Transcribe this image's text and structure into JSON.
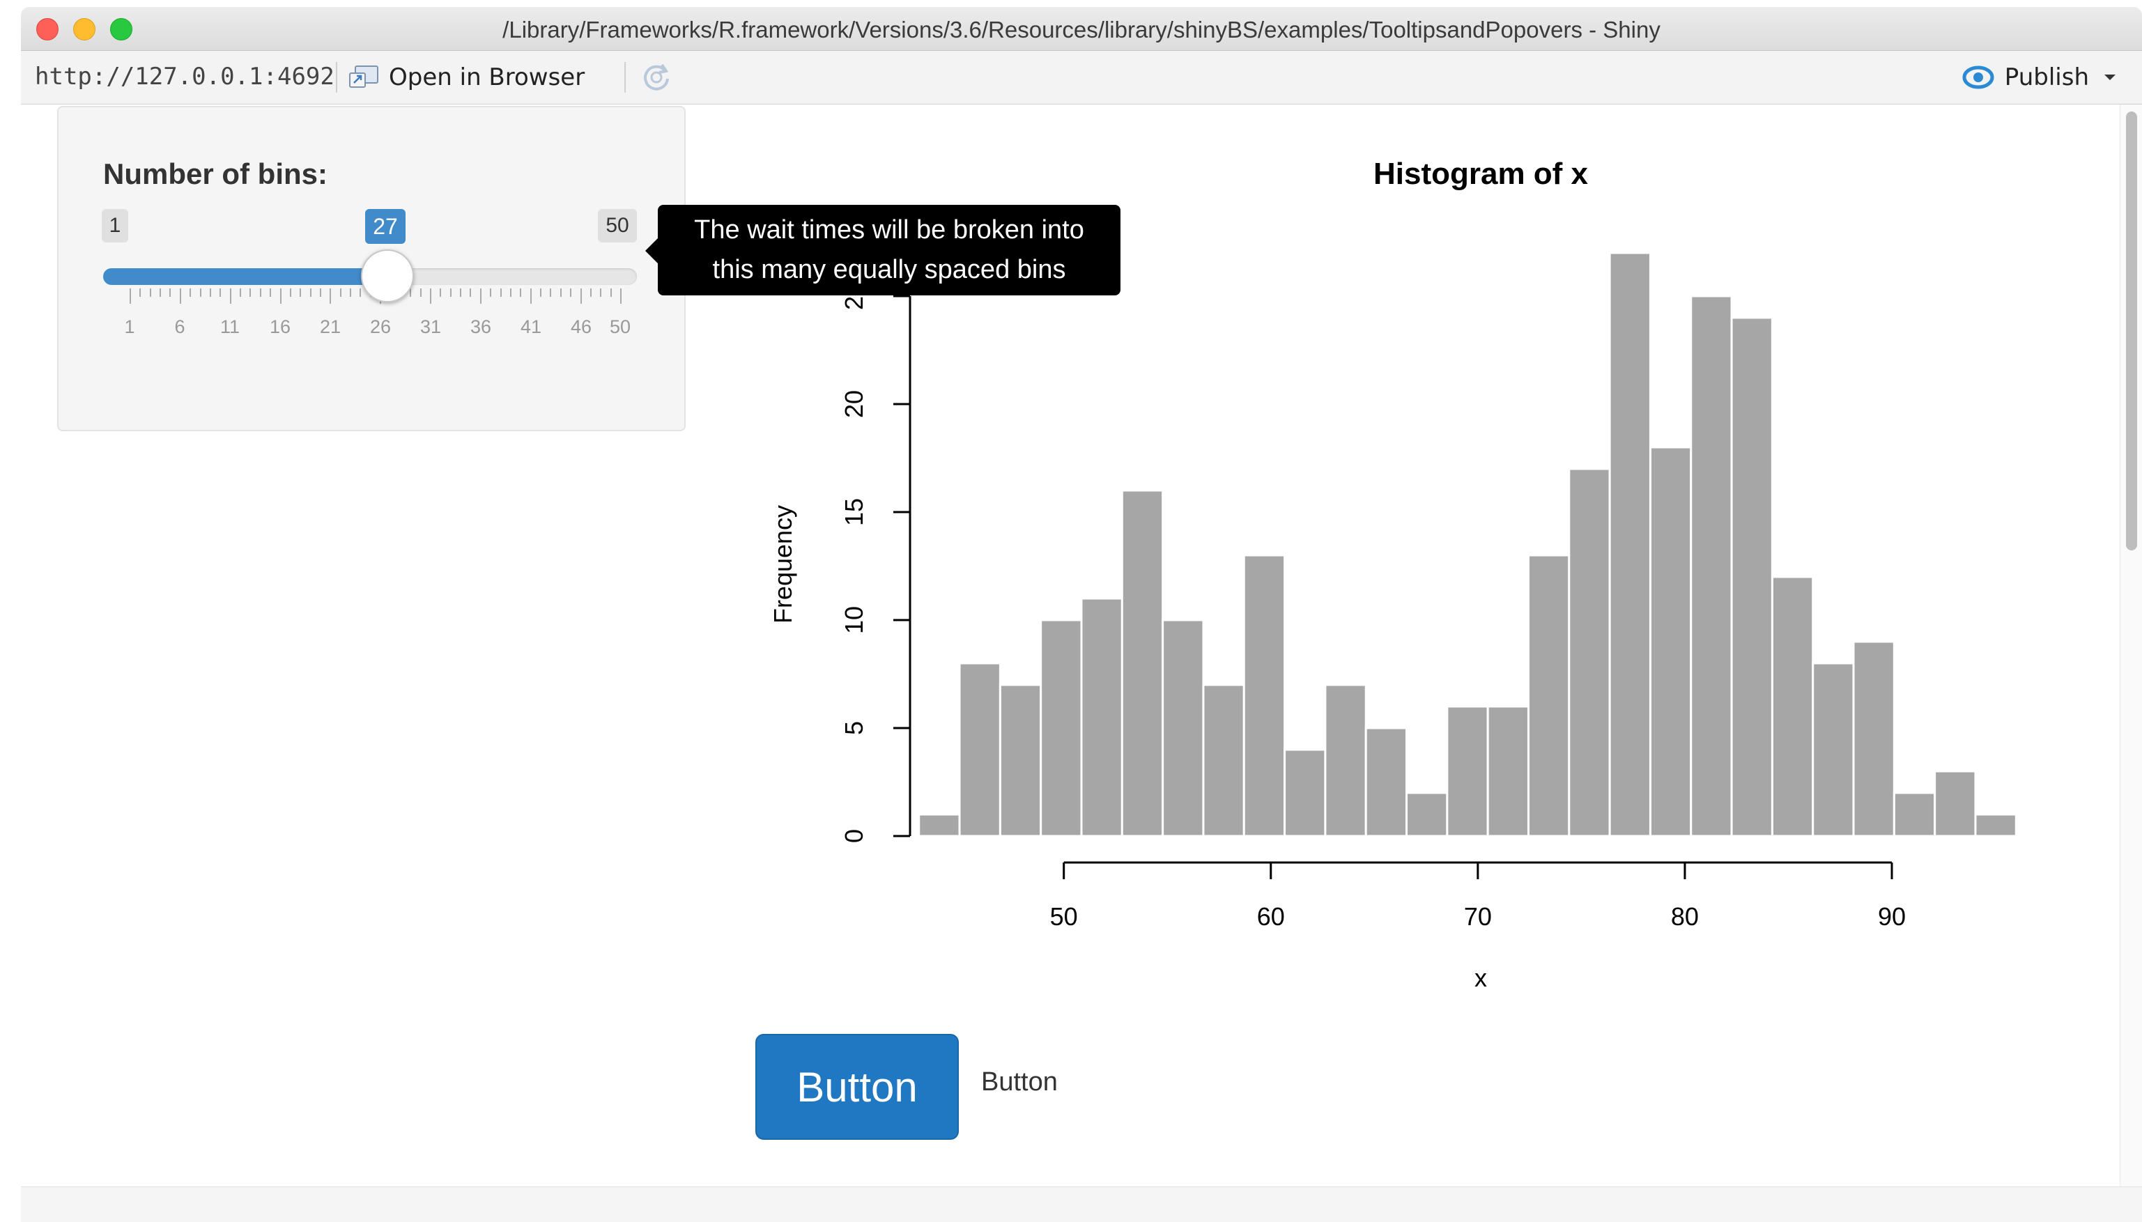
{
  "window": {
    "title": "/Library/Frameworks/R.framework/Versions/3.6/Resources/library/shinyBS/examples/TooltipsandPopovers - Shiny"
  },
  "toolbar": {
    "url": "http://127.0.0.1:4692",
    "open_browser_label": "Open in Browser",
    "publish_label": "Publish",
    "icons": [
      "open-in-browser-icon",
      "refresh-icon",
      "publish-icon",
      "chevron-down-icon"
    ]
  },
  "slider": {
    "label": "Number of bins:",
    "min": "1",
    "max": "50",
    "value": "27",
    "value_fraction": 0.5306,
    "ticks": [
      "1",
      "6",
      "11",
      "16",
      "21",
      "26",
      "31",
      "36",
      "41",
      "46",
      "50"
    ],
    "accent": "#428bca"
  },
  "tooltip": {
    "line1": "The wait times will be broken into",
    "line2": "this many equally spaced bins"
  },
  "chart_data": {
    "type": "bar",
    "title": "Histogram of x",
    "xlabel": "x",
    "ylabel": "Frequency",
    "xlim": [
      42.1,
      96.9
    ],
    "ylim": [
      0,
      27
    ],
    "x_ticks": [
      "50",
      "60",
      "70",
      "80",
      "90"
    ],
    "y_ticks": [
      "0",
      "5",
      "10",
      "15",
      "20",
      "25"
    ],
    "bin_start": 43.0,
    "bin_width": 1.963,
    "values": [
      1,
      8,
      7,
      10,
      11,
      16,
      10,
      7,
      13,
      4,
      7,
      5,
      2,
      6,
      6,
      13,
      17,
      27,
      18,
      25,
      24,
      12,
      8,
      9,
      2,
      3,
      1
    ],
    "bar_color": "#a6a6a6"
  },
  "buttons": {
    "primary_label": "Button",
    "secondary_label": "Button"
  }
}
